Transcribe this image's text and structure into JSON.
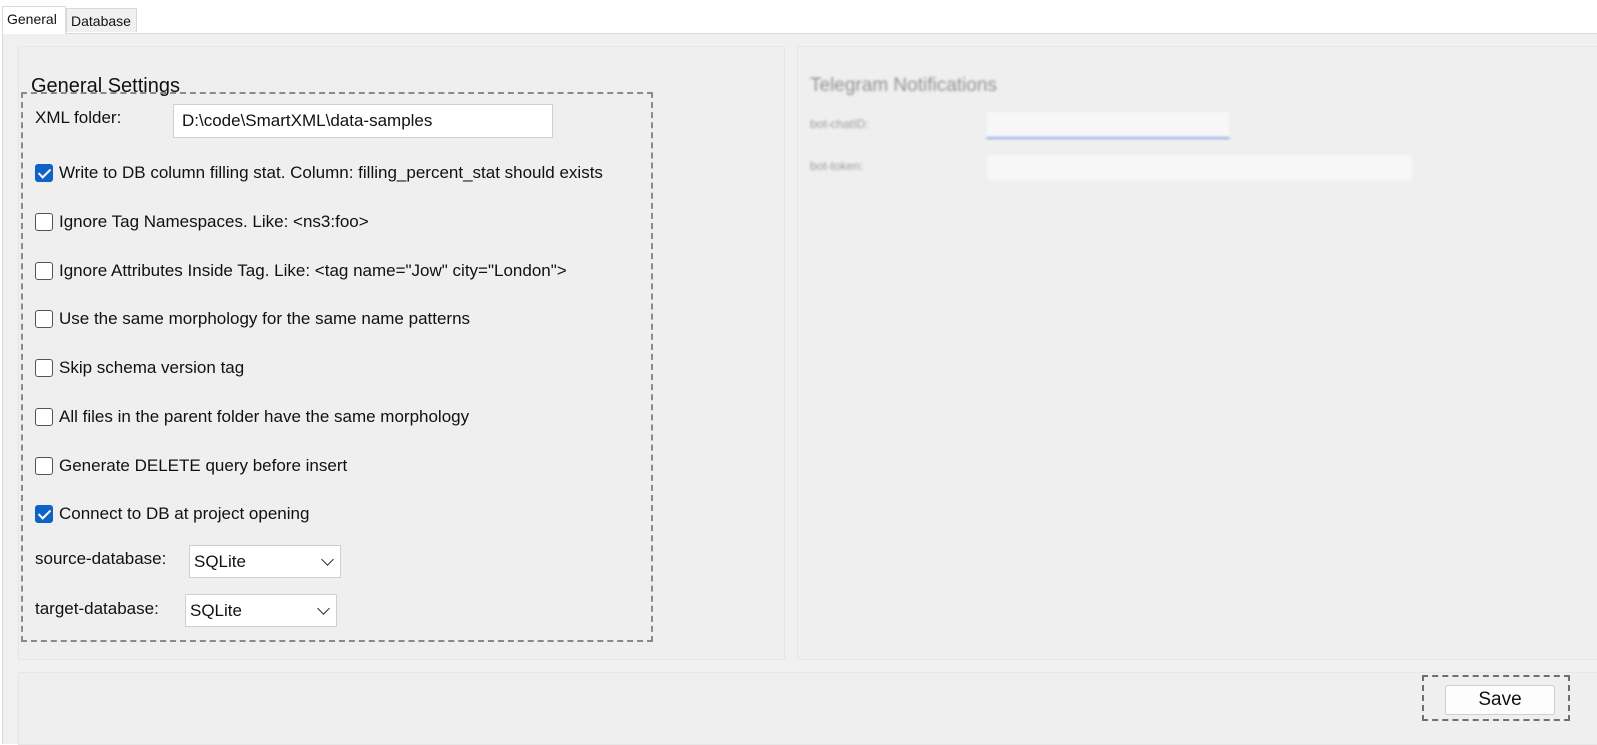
{
  "tabs": [
    {
      "label": "General",
      "active": true
    },
    {
      "label": "Database",
      "active": false
    }
  ],
  "general_settings": {
    "title": "General Settings",
    "xml_folder_label": "XML folder:",
    "xml_folder_value": "D:\\code\\SmartXML\\data-samples",
    "options": [
      {
        "label": "Write to DB column filling stat. Column: filling_percent_stat should exists",
        "checked": true
      },
      {
        "label": "Ignore Tag Namespaces. Like: <ns3:foo>",
        "checked": false
      },
      {
        "label": "Ignore Attributes Inside Tag. Like: <tag name=\"Jow\" city=\"London\">",
        "checked": false
      },
      {
        "label": "Use the same morphology for the same name patterns",
        "checked": false
      },
      {
        "label": "Skip schema version tag",
        "checked": false
      },
      {
        "label": "All files in the parent folder have the same morphology",
        "checked": false
      },
      {
        "label": "Generate DELETE query before insert",
        "checked": false
      },
      {
        "label": "Connect to DB at project opening",
        "checked": true
      }
    ],
    "source_database_label": "source-database:",
    "source_database_value": "SQLite",
    "target_database_label": "target-database:",
    "target_database_value": "SQLite"
  },
  "telegram": {
    "title": "Telegram Notifications",
    "bot_chat_id_label": "bot-chatID:",
    "bot_chat_id_value": "",
    "bot_token_label": "bot-token:",
    "bot_token_value": ""
  },
  "footer": {
    "save_label": "Save"
  },
  "colors": {
    "accent": "#0f63c7",
    "panel_bg": "#efefef"
  }
}
